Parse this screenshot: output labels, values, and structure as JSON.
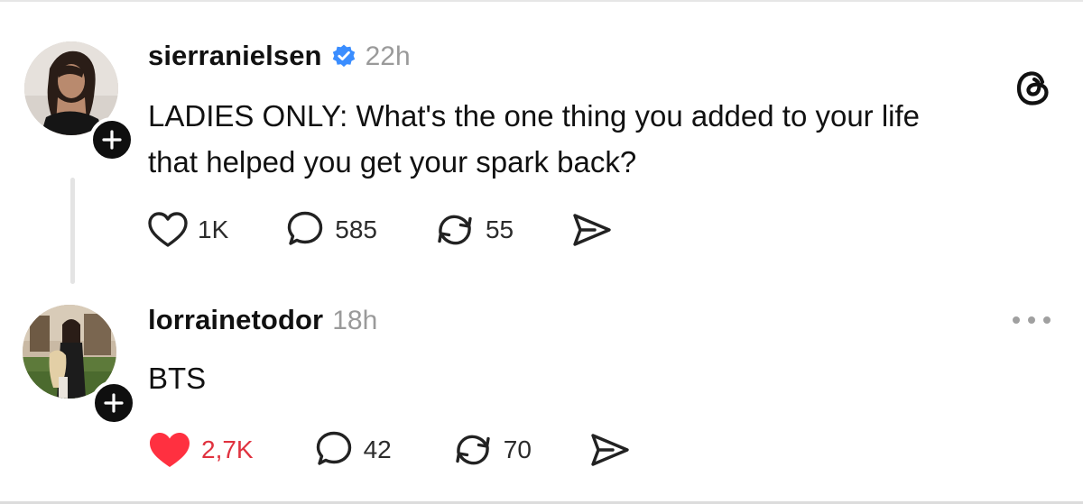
{
  "app": {
    "logo_icon": "threads-logo-icon",
    "accent_like": "#ff3040",
    "verified_color": "#3a8dff"
  },
  "post": {
    "username": "sierranielsen",
    "verified": true,
    "time": "22h",
    "text_lines": [
      "LADIES ONLY: What's the one thing you added to your life",
      "that helped you get your spark back?"
    ],
    "likes": "1K",
    "replies": "585",
    "reposts": "55",
    "liked": false
  },
  "reply": {
    "username": "lorrainetodor",
    "time": "18h",
    "text": "BTS",
    "likes": "2,7K",
    "replies": "42",
    "reposts": "70",
    "liked": true
  }
}
